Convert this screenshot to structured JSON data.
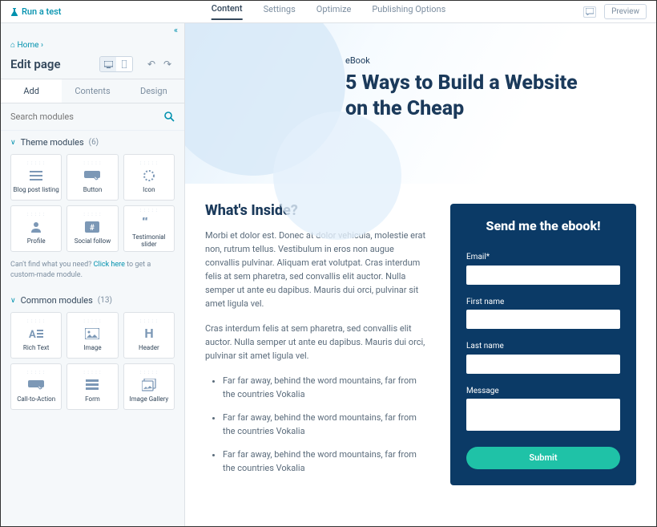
{
  "topbar": {
    "run_test": "Run a test",
    "tabs": [
      "Content",
      "Settings",
      "Optimize",
      "Publishing Options"
    ],
    "preview": "Preview"
  },
  "sidebar": {
    "breadcrumb": "Home",
    "title": "Edit page",
    "panel_tabs": [
      "Add",
      "Contents",
      "Design"
    ],
    "search_placeholder": "Search modules",
    "sections": [
      {
        "label": "Theme modules",
        "count": "(6)",
        "items": [
          "Blog post listing",
          "Button",
          "Icon",
          "Profile",
          "Social follow",
          "Testimonial slider"
        ]
      },
      {
        "label": "Common modules",
        "count": "(13)",
        "items": [
          "Rich Text",
          "Image",
          "Header",
          "Call-to-Action",
          "Form",
          "Image Gallery"
        ]
      }
    ],
    "hint_before": "Can't find what you need? ",
    "hint_link": "Click here",
    "hint_after": " to get a custom-made module."
  },
  "page": {
    "eyebrow": "eBook",
    "title": "5 Ways to Build a Website on the Cheap",
    "heading": "What's Inside?",
    "para1": "Morbi et dolor est. Donec at dolor vehicula, molestie erat non, rutrum tellus. Vestibulum in eros non augue convallis pulvinar. Aliquam erat volutpat. Cras interdum felis at sem pharetra, sed convallis elit auctor. Nulla semper ut ante eu dapibus. Mauris dui orci, pulvinar sit amet ligula vel.",
    "para2": "Cras interdum felis at sem pharetra, sed convallis elit auctor. Nulla semper ut ante eu dapibus. Mauris dui orci, pulvinar sit amet ligula vel.",
    "bullets": [
      "Far far away, behind the word mountains, far from the countries Vokalia",
      "Far far away, behind the word mountains, far from the countries Vokalia",
      "Far far away, behind the word mountains, far from the countries Vokalia"
    ]
  },
  "form": {
    "title": "Send me the ebook!",
    "labels": {
      "email": "Email*",
      "first": "First name",
      "last": "Last name",
      "message": "Message"
    },
    "submit": "Submit"
  }
}
